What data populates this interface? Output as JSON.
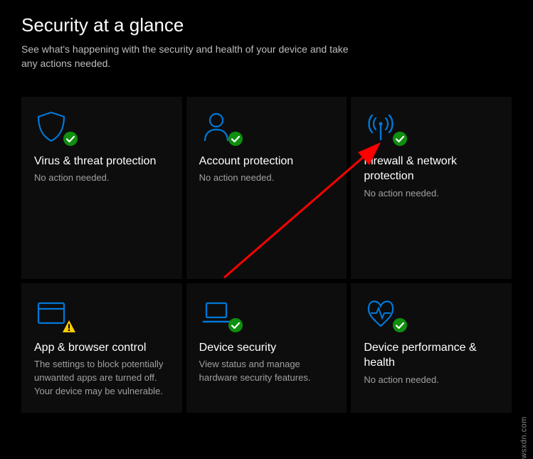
{
  "header": {
    "title": "Security at a glance",
    "subtitle": "See what's happening with the security and health of your device and take any actions needed."
  },
  "status_colors": {
    "ok": "#0f8f0f",
    "warn": "#ffcc00",
    "icon_blue": "#0078d7"
  },
  "tiles": [
    {
      "key": "virus",
      "title": "Virus & threat protection",
      "status": "No action needed."
    },
    {
      "key": "account",
      "title": "Account protection",
      "status": "No action needed."
    },
    {
      "key": "firewall",
      "title": "Firewall & network protection",
      "status": "No action needed."
    },
    {
      "key": "appbrowser",
      "title": "App & browser control",
      "status": "The settings to block potentially unwanted apps are turned off. Your device may be vulnerable."
    },
    {
      "key": "devicesecurity",
      "title": "Device security",
      "status": "View status and manage hardware security features."
    },
    {
      "key": "performance",
      "title": "Device performance & health",
      "status": "No action needed."
    }
  ],
  "watermark": "wsxdn.com"
}
